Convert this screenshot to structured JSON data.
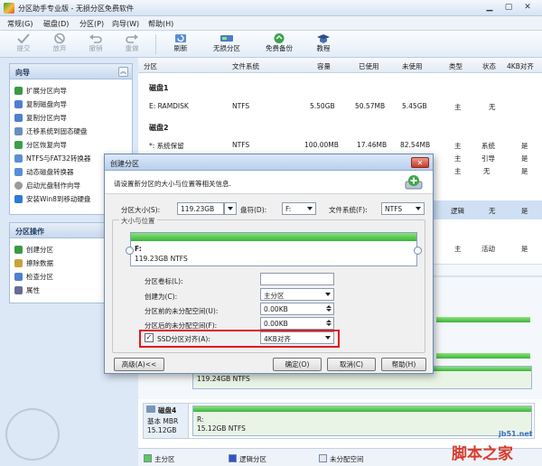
{
  "window": {
    "title": "分区助手专业版 - 无损分区免费软件"
  },
  "menu": [
    "常规(G)",
    "磁盘(D)",
    "分区(P)",
    "向导(W)",
    "帮助(H)"
  ],
  "toolbar": {
    "buttons": [
      {
        "label": "提交",
        "icon": "check-icon",
        "enabled": false
      },
      {
        "label": "放弃",
        "icon": "discard-icon",
        "enabled": false
      },
      {
        "label": "撤销",
        "icon": "undo-icon",
        "enabled": false
      },
      {
        "label": "重做",
        "icon": "redo-icon",
        "enabled": false
      },
      {
        "label": "刷新",
        "icon": "refresh-icon",
        "enabled": true
      },
      {
        "label": "无损分区",
        "icon": "partition-icon",
        "enabled": true
      },
      {
        "label": "免费备份",
        "icon": "backup-icon",
        "enabled": true
      },
      {
        "label": "教程",
        "icon": "tutorial-icon",
        "enabled": true
      }
    ]
  },
  "sidebar": {
    "wizard_title": "向导",
    "wizard_items": [
      "扩展分区向导",
      "复制磁盘向导",
      "复制分区向导",
      "迁移系统到固态硬盘",
      "分区恢复向导",
      "NTFS与FAT32转换器",
      "动态磁盘转换器",
      "启动光盘制作向导",
      "安装Win8到移动硬盘"
    ],
    "ops_title": "分区操作",
    "ops_items": [
      "创建分区",
      "擦除数据",
      "检查分区",
      "属性"
    ]
  },
  "table": {
    "headers": [
      "分区",
      "文件系统",
      "容量",
      "已使用",
      "未使用",
      "类型",
      "状态",
      "4KB对齐"
    ],
    "disk1": {
      "label": "磁盘1",
      "rows": [
        {
          "part": "E: RAMDISK",
          "fs": "NTFS",
          "cap": "5.50GB",
          "used": "50.57MB",
          "free": "5.45GB",
          "type": "主",
          "status": "无",
          "align": ""
        }
      ]
    },
    "disk2": {
      "label": "磁盘2",
      "rows": [
        {
          "part": "*: 系统保留",
          "fs": "NTFS",
          "cap": "100.00MB",
          "used": "17.46MB",
          "free": "82.54MB",
          "type": "主",
          "status": "系统",
          "align": "是"
        },
        {
          "part": "",
          "fs": "",
          "cap": "",
          "used": "",
          "free": "",
          "type": "主",
          "status": "引导",
          "align": "是"
        },
        {
          "part": "",
          "fs": "",
          "cap": "",
          "used": "",
          "free": "",
          "type": "主",
          "status": "无",
          "align": "是"
        }
      ]
    },
    "partial_rows": [
      {
        "type": "逻辑",
        "status": "无",
        "align": "是"
      },
      {
        "type": "主",
        "status": "活动",
        "align": "是"
      }
    ]
  },
  "diskmap": {
    "bar1_text": "119.24GB NTFS",
    "disk4": {
      "name": "磁盘4",
      "kind": "基本 MBR",
      "size": "15.12GB",
      "part_label": "R:",
      "part_size": "15.12GB NTFS"
    }
  },
  "legend": [
    "主分区",
    "逻辑分区",
    "未分配空间"
  ],
  "dialog": {
    "title": "创建分区",
    "description": "请设置新分区的大小与位置等相关信息.",
    "size_label": "分区大小(S):",
    "size_value": "119.23GB",
    "letter_label": "盘符(D):",
    "letter_value": "F:",
    "fs_label": "文件系统(F):",
    "fs_value": "NTFS",
    "group_label": "大小与位置",
    "bar_letter": "F:",
    "bar_text": "119.23GB NTFS",
    "vol_label": "分区卷标(L):",
    "vol_value": "",
    "create_as_label": "创建为(C):",
    "create_as_value": "主分区",
    "before_label": "分区前的未分配空间(U):",
    "before_value": "0.00KB",
    "after_label": "分区后的未分配空间(F):",
    "after_value": "0.00KB",
    "ssd_label": "SSD分区对齐(A):",
    "ssd_value": "4KB对齐",
    "ssd_checked": true,
    "advanced_btn": "高级(A)<<",
    "ok_btn": "确定(O)",
    "cancel_btn": "取消(C)",
    "help_btn": "帮助(H)"
  },
  "watermark": {
    "site": "jb51.net",
    "brand": "脚本之家"
  }
}
